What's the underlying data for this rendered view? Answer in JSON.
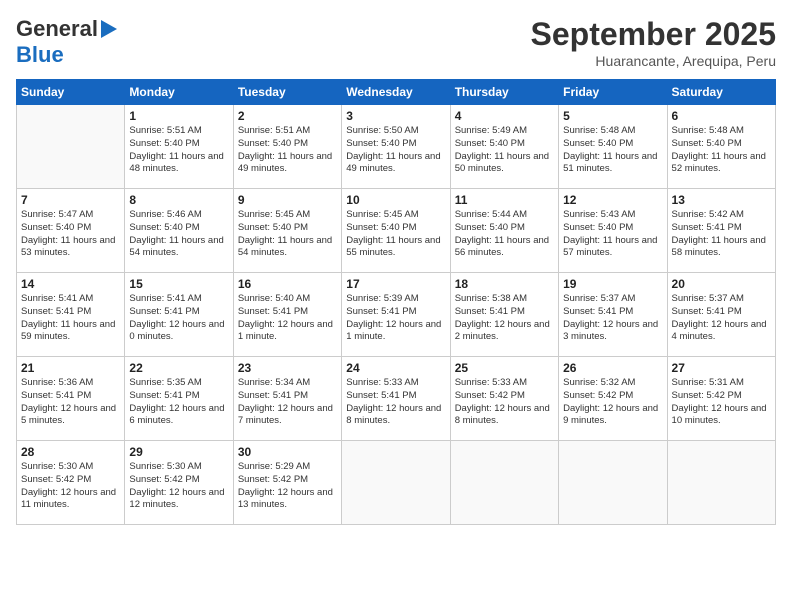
{
  "header": {
    "logo_line1": "General",
    "logo_line2": "Blue",
    "month_year": "September 2025",
    "location": "Huarancante, Arequipa, Peru"
  },
  "weekdays": [
    "Sunday",
    "Monday",
    "Tuesday",
    "Wednesday",
    "Thursday",
    "Friday",
    "Saturday"
  ],
  "weeks": [
    [
      {
        "day": "",
        "sunrise": "",
        "sunset": "",
        "daylight": ""
      },
      {
        "day": "1",
        "sunrise": "Sunrise: 5:51 AM",
        "sunset": "Sunset: 5:40 PM",
        "daylight": "Daylight: 11 hours and 48 minutes."
      },
      {
        "day": "2",
        "sunrise": "Sunrise: 5:51 AM",
        "sunset": "Sunset: 5:40 PM",
        "daylight": "Daylight: 11 hours and 49 minutes."
      },
      {
        "day": "3",
        "sunrise": "Sunrise: 5:50 AM",
        "sunset": "Sunset: 5:40 PM",
        "daylight": "Daylight: 11 hours and 49 minutes."
      },
      {
        "day": "4",
        "sunrise": "Sunrise: 5:49 AM",
        "sunset": "Sunset: 5:40 PM",
        "daylight": "Daylight: 11 hours and 50 minutes."
      },
      {
        "day": "5",
        "sunrise": "Sunrise: 5:48 AM",
        "sunset": "Sunset: 5:40 PM",
        "daylight": "Daylight: 11 hours and 51 minutes."
      },
      {
        "day": "6",
        "sunrise": "Sunrise: 5:48 AM",
        "sunset": "Sunset: 5:40 PM",
        "daylight": "Daylight: 11 hours and 52 minutes."
      }
    ],
    [
      {
        "day": "7",
        "sunrise": "Sunrise: 5:47 AM",
        "sunset": "Sunset: 5:40 PM",
        "daylight": "Daylight: 11 hours and 53 minutes."
      },
      {
        "day": "8",
        "sunrise": "Sunrise: 5:46 AM",
        "sunset": "Sunset: 5:40 PM",
        "daylight": "Daylight: 11 hours and 54 minutes."
      },
      {
        "day": "9",
        "sunrise": "Sunrise: 5:45 AM",
        "sunset": "Sunset: 5:40 PM",
        "daylight": "Daylight: 11 hours and 54 minutes."
      },
      {
        "day": "10",
        "sunrise": "Sunrise: 5:45 AM",
        "sunset": "Sunset: 5:40 PM",
        "daylight": "Daylight: 11 hours and 55 minutes."
      },
      {
        "day": "11",
        "sunrise": "Sunrise: 5:44 AM",
        "sunset": "Sunset: 5:40 PM",
        "daylight": "Daylight: 11 hours and 56 minutes."
      },
      {
        "day": "12",
        "sunrise": "Sunrise: 5:43 AM",
        "sunset": "Sunset: 5:40 PM",
        "daylight": "Daylight: 11 hours and 57 minutes."
      },
      {
        "day": "13",
        "sunrise": "Sunrise: 5:42 AM",
        "sunset": "Sunset: 5:41 PM",
        "daylight": "Daylight: 11 hours and 58 minutes."
      }
    ],
    [
      {
        "day": "14",
        "sunrise": "Sunrise: 5:41 AM",
        "sunset": "Sunset: 5:41 PM",
        "daylight": "Daylight: 11 hours and 59 minutes."
      },
      {
        "day": "15",
        "sunrise": "Sunrise: 5:41 AM",
        "sunset": "Sunset: 5:41 PM",
        "daylight": "Daylight: 12 hours and 0 minutes."
      },
      {
        "day": "16",
        "sunrise": "Sunrise: 5:40 AM",
        "sunset": "Sunset: 5:41 PM",
        "daylight": "Daylight: 12 hours and 1 minute."
      },
      {
        "day": "17",
        "sunrise": "Sunrise: 5:39 AM",
        "sunset": "Sunset: 5:41 PM",
        "daylight": "Daylight: 12 hours and 1 minute."
      },
      {
        "day": "18",
        "sunrise": "Sunrise: 5:38 AM",
        "sunset": "Sunset: 5:41 PM",
        "daylight": "Daylight: 12 hours and 2 minutes."
      },
      {
        "day": "19",
        "sunrise": "Sunrise: 5:37 AM",
        "sunset": "Sunset: 5:41 PM",
        "daylight": "Daylight: 12 hours and 3 minutes."
      },
      {
        "day": "20",
        "sunrise": "Sunrise: 5:37 AM",
        "sunset": "Sunset: 5:41 PM",
        "daylight": "Daylight: 12 hours and 4 minutes."
      }
    ],
    [
      {
        "day": "21",
        "sunrise": "Sunrise: 5:36 AM",
        "sunset": "Sunset: 5:41 PM",
        "daylight": "Daylight: 12 hours and 5 minutes."
      },
      {
        "day": "22",
        "sunrise": "Sunrise: 5:35 AM",
        "sunset": "Sunset: 5:41 PM",
        "daylight": "Daylight: 12 hours and 6 minutes."
      },
      {
        "day": "23",
        "sunrise": "Sunrise: 5:34 AM",
        "sunset": "Sunset: 5:41 PM",
        "daylight": "Daylight: 12 hours and 7 minutes."
      },
      {
        "day": "24",
        "sunrise": "Sunrise: 5:33 AM",
        "sunset": "Sunset: 5:41 PM",
        "daylight": "Daylight: 12 hours and 8 minutes."
      },
      {
        "day": "25",
        "sunrise": "Sunrise: 5:33 AM",
        "sunset": "Sunset: 5:42 PM",
        "daylight": "Daylight: 12 hours and 8 minutes."
      },
      {
        "day": "26",
        "sunrise": "Sunrise: 5:32 AM",
        "sunset": "Sunset: 5:42 PM",
        "daylight": "Daylight: 12 hours and 9 minutes."
      },
      {
        "day": "27",
        "sunrise": "Sunrise: 5:31 AM",
        "sunset": "Sunset: 5:42 PM",
        "daylight": "Daylight: 12 hours and 10 minutes."
      }
    ],
    [
      {
        "day": "28",
        "sunrise": "Sunrise: 5:30 AM",
        "sunset": "Sunset: 5:42 PM",
        "daylight": "Daylight: 12 hours and 11 minutes."
      },
      {
        "day": "29",
        "sunrise": "Sunrise: 5:30 AM",
        "sunset": "Sunset: 5:42 PM",
        "daylight": "Daylight: 12 hours and 12 minutes."
      },
      {
        "day": "30",
        "sunrise": "Sunrise: 5:29 AM",
        "sunset": "Sunset: 5:42 PM",
        "daylight": "Daylight: 12 hours and 13 minutes."
      },
      {
        "day": "",
        "sunrise": "",
        "sunset": "",
        "daylight": ""
      },
      {
        "day": "",
        "sunrise": "",
        "sunset": "",
        "daylight": ""
      },
      {
        "day": "",
        "sunrise": "",
        "sunset": "",
        "daylight": ""
      },
      {
        "day": "",
        "sunrise": "",
        "sunset": "",
        "daylight": ""
      }
    ]
  ]
}
